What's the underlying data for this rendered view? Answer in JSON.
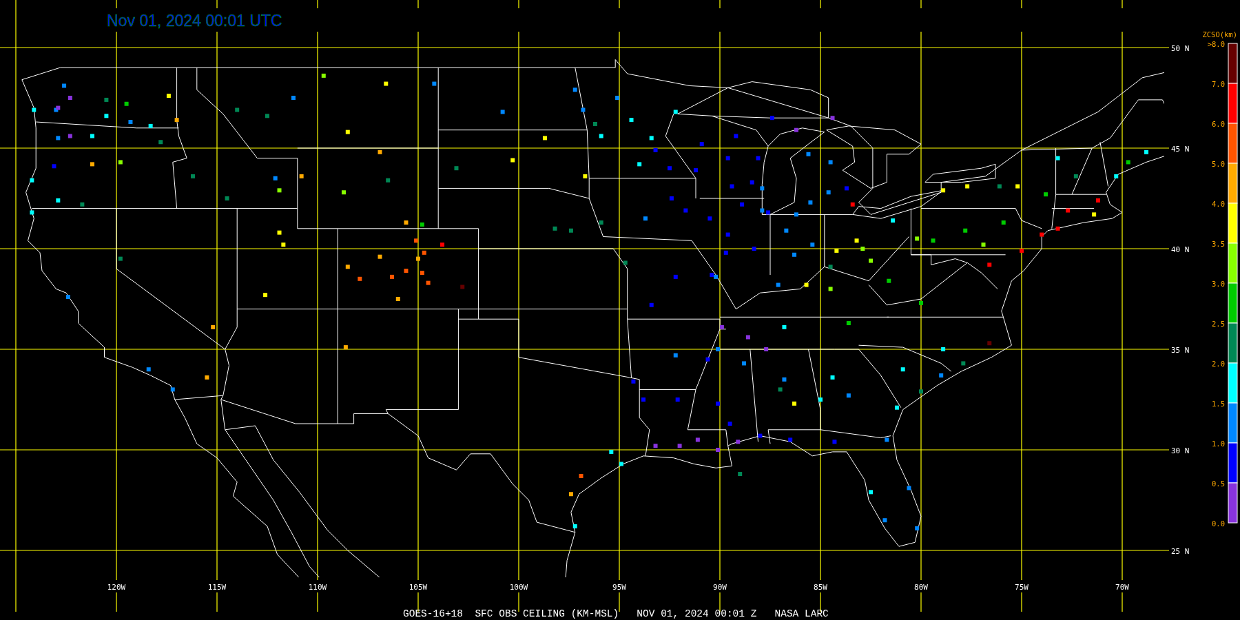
{
  "title": "Nov 01, 2024 00:01 UTC",
  "legend": {
    "title": "ZCSO(km)",
    "labels": [
      ">8.0",
      "7.0",
      "6.0",
      "5.0",
      "4.0",
      "3.5",
      "3.0",
      "2.5",
      "2.0",
      "1.5",
      "1.0",
      "0.5",
      "0.0"
    ],
    "bands": [
      {
        "color": "#660000"
      },
      {
        "color": "#ff0000"
      },
      {
        "color": "#ff5500"
      },
      {
        "color": "#ffaa00"
      },
      {
        "color": "#ffff00"
      },
      {
        "color": "#88ff00"
      },
      {
        "color": "#00cc00"
      },
      {
        "color": "#008855"
      },
      {
        "color": "#00ffff"
      },
      {
        "color": "#0088ff"
      },
      {
        "color": "#0000ff"
      },
      {
        "color": "#8833dd"
      }
    ]
  },
  "latitude_labels": [
    "50 N",
    "45 N",
    "40 N",
    "35 N",
    "30 N",
    "25 N"
  ],
  "longitude_labels": [
    "120W",
    "115W",
    "110W",
    "105W",
    "100W",
    "95W",
    "90W",
    "85W",
    "80W",
    "75W",
    "70W"
  ],
  "caption": "GOES-16+18  SFC OBS CEILING (KM-MSL)   NOV 01, 2024 00:01 Z   NASA LARC"
}
